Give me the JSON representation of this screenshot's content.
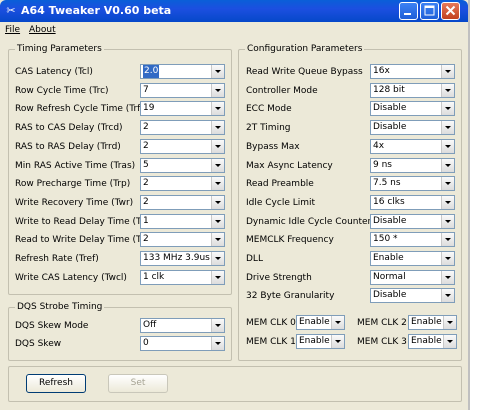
{
  "window": {
    "title": "A64 Tweaker V0.60 beta",
    "colors": {
      "titlebar": "#0548c9",
      "face": "#ece9d8",
      "selection": "#316ac5"
    }
  },
  "menu": {
    "file": "File",
    "about": "About"
  },
  "timing": {
    "title": "Timing Parameters",
    "rows": [
      {
        "label": "CAS Latency (Tcl)",
        "value": "2.0"
      },
      {
        "label": "Row Cycle Time (Trc)",
        "value": "7"
      },
      {
        "label": "Row Refresh Cycle Time (Trfc)",
        "value": "19"
      },
      {
        "label": "RAS to CAS Delay (Trcd)",
        "value": "2"
      },
      {
        "label": "RAS to RAS Delay (Trrd)",
        "value": "2"
      },
      {
        "label": "Min RAS Active Time (Tras)",
        "value": "5"
      },
      {
        "label": "Row Precharge Time (Trp)",
        "value": "2"
      },
      {
        "label": "Write Recovery Time (Twr)",
        "value": "2"
      },
      {
        "label": "Write to Read Delay Time (Twtr)",
        "value": "1"
      },
      {
        "label": "Read to Write Delay Time (Trtw)",
        "value": "2"
      },
      {
        "label": "Refresh Rate (Tref)",
        "value": "133 MHz 3.9us"
      },
      {
        "label": "Write CAS Latency (Twcl)",
        "value": "1 clk"
      }
    ]
  },
  "dqs": {
    "title": "DQS Strobe Timing",
    "rows": [
      {
        "label": "DQS Skew Mode",
        "value": "Off"
      },
      {
        "label": "DQS Skew",
        "value": "0"
      }
    ]
  },
  "config": {
    "title": "Configuration Parameters",
    "rows": [
      {
        "label": "Read Write Queue Bypass",
        "value": "16x"
      },
      {
        "label": "Controller Mode",
        "value": "128 bit"
      },
      {
        "label": "ECC Mode",
        "value": "Disable"
      },
      {
        "label": "2T Timing",
        "value": "Disable"
      },
      {
        "label": "Bypass Max",
        "value": "4x"
      },
      {
        "label": "Max Async Latency",
        "value": "9 ns"
      },
      {
        "label": "Read Preamble",
        "value": "7.5 ns"
      },
      {
        "label": "Idle Cycle Limit",
        "value": "16 clks"
      },
      {
        "label": "Dynamic Idle Cycle Counter",
        "value": "Disable"
      },
      {
        "label": "MEMCLK Frequency",
        "value": "150 *"
      },
      {
        "label": "DLL",
        "value": "Enable"
      },
      {
        "label": "Drive Strength",
        "value": "Normal"
      },
      {
        "label": "32 Byte Granularity",
        "value": "Disable"
      }
    ],
    "memclk": [
      {
        "label": "MEM CLK 0",
        "value": "Enable"
      },
      {
        "label": "MEM CLK 2",
        "value": "Enable"
      },
      {
        "label": "MEM CLK 1",
        "value": "Enable"
      },
      {
        "label": "MEM CLK 3",
        "value": "Enable"
      }
    ]
  },
  "buttons": {
    "refresh": "Refresh",
    "set": "Set"
  }
}
